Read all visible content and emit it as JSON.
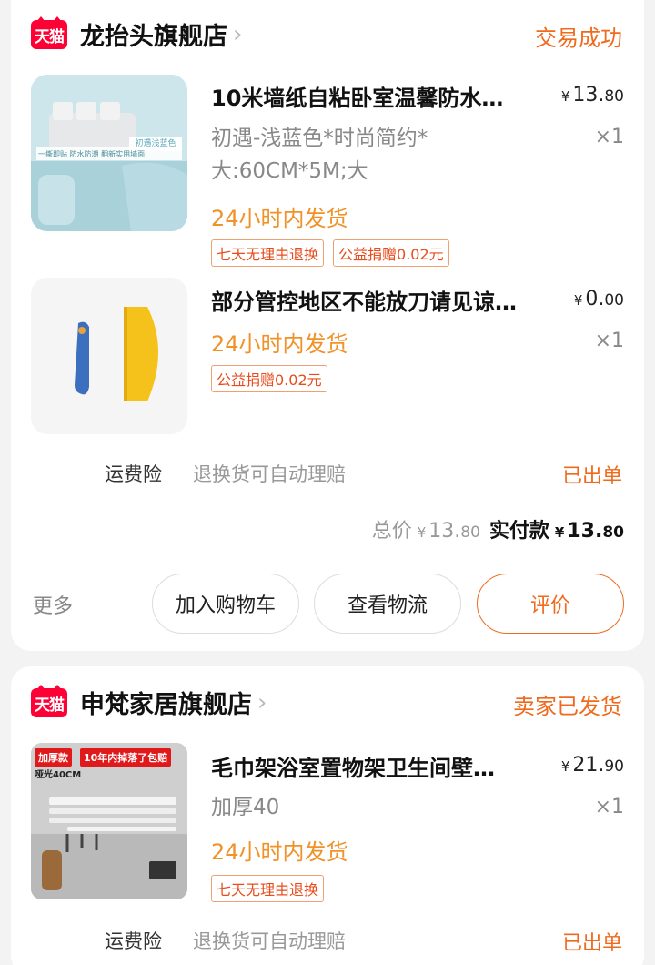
{
  "orders": [
    {
      "logo_text": "天猫",
      "shop_name": "龙抬头旗舰店",
      "status": "交易成功",
      "items": [
        {
          "title": "10米墙纸自粘卧室温馨防水…",
          "price_currency": "¥",
          "price_int": "13.",
          "price_dec": "80",
          "qty": "×1",
          "sku": "初遇-浅蓝色*时尚简约*大:60CM*5M;大",
          "ship": "24小时内发货",
          "tags": [
            "七天无理由退换",
            "公益捐赠0.02元"
          ],
          "thumb_caption": "初遇浅蓝色",
          "thumb_features": "一撕即贴   防水防潮   翻新实用墙面"
        },
        {
          "title": "部分管控地区不能放刀请见谅…",
          "price_currency": "¥",
          "price_int": "0.",
          "price_dec": "00",
          "qty": "×1",
          "ship": "24小时内发货",
          "tags": [
            "公益捐赠0.02元"
          ]
        }
      ],
      "insurance_label": "运费险",
      "insurance_desc": "退换货可自动理赔",
      "insurance_status": "已出单",
      "total_label": "总价",
      "total_currency": "¥",
      "total_int": "13.",
      "total_dec": "80",
      "paid_label": "实付款",
      "paid_currency": "¥",
      "paid_int": "13.",
      "paid_dec": "80",
      "more_label": "更多",
      "buttons": [
        "加入购物车",
        "查看物流",
        "评价"
      ]
    },
    {
      "logo_text": "天猫",
      "shop_name": "申梵家居旗舰店",
      "status": "卖家已发货",
      "items": [
        {
          "title": "毛巾架浴室置物架卫生间壁…",
          "price_currency": "¥",
          "price_int": "21.",
          "price_dec": "90",
          "qty": "×1",
          "sku": "加厚40",
          "ship": "24小时内发货",
          "tags": [
            "七天无理由退换"
          ],
          "thumb_badge_left": "加厚款",
          "thumb_badge_right": "10年内掉落了包赔",
          "thumb_sub": "哑光40CM"
        }
      ],
      "insurance_label": "运费险",
      "insurance_desc": "退换货可自动理赔",
      "insurance_status": "已出单"
    }
  ],
  "colors": {
    "accent": "#f06a1e",
    "shipping": "#f09228",
    "tmall_red": "#ff0036"
  }
}
